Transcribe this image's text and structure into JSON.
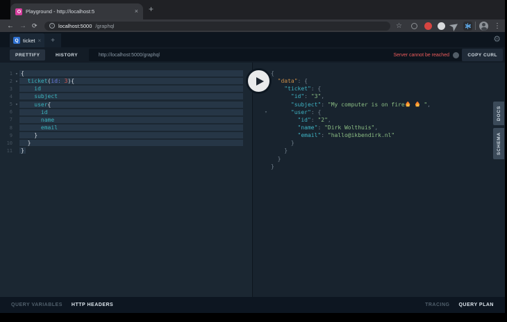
{
  "icons": {
    "back": "←",
    "forward": "→",
    "refresh": "⟳",
    "star": "☆",
    "menu": "⋮",
    "gear": "⚙",
    "fold": "▾",
    "plus": "+",
    "close": "×",
    "info": "i"
  },
  "browser": {
    "tab_title": "Playground - http://localhost:5",
    "url_host": "localhost:5000",
    "url_path": "/graphql"
  },
  "playground": {
    "session_tab": {
      "badge": "Q",
      "label": "ticket"
    },
    "toolbar": {
      "prettify": "PRETTIFY",
      "history": "HISTORY",
      "endpoint": "http://localhost:5000/graphql",
      "status": "Server cannot be reached",
      "copy_curl": "COPY CURL"
    },
    "side_tabs": [
      "DOCS",
      "SCHEMA"
    ],
    "bottom_left": [
      "QUERY VARIABLES",
      "HTTP HEADERS"
    ],
    "bottom_right": [
      "TRACING",
      "QUERY PLAN"
    ],
    "colors": {
      "field": "#3bb3bd",
      "argument": "#6a7ce0",
      "number": "#d1544e",
      "json_key": "#3fb3c4",
      "json_data_key": "#c98c47",
      "json_string": "#8cbe84",
      "status_red": "#ee5c5c",
      "selection": "#263646",
      "pane_bg": "#1b2732"
    },
    "query_editor": {
      "lines": [
        {
          "n": 1,
          "fold": true,
          "sel": "full",
          "segs": [
            {
              "t": "{",
              "c": "p"
            }
          ]
        },
        {
          "n": 2,
          "fold": true,
          "sel": "full",
          "segs": [
            {
              "t": "  ",
              "c": "p"
            },
            {
              "t": "ticket",
              "c": "field"
            },
            {
              "t": "(",
              "c": "p"
            },
            {
              "t": "id:",
              "c": "attr"
            },
            {
              "t": " ",
              "c": "p"
            },
            {
              "t": "3",
              "c": "num"
            },
            {
              "t": "){",
              "c": "p"
            }
          ]
        },
        {
          "n": 3,
          "sel": "full",
          "segs": [
            {
              "t": "    ",
              "c": "p"
            },
            {
              "t": "id",
              "c": "field"
            }
          ]
        },
        {
          "n": 4,
          "sel": "full",
          "segs": [
            {
              "t": "    ",
              "c": "p"
            },
            {
              "t": "subject",
              "c": "field"
            }
          ]
        },
        {
          "n": 5,
          "fold": true,
          "sel": "full",
          "segs": [
            {
              "t": "    ",
              "c": "p"
            },
            {
              "t": "user",
              "c": "field"
            },
            {
              "t": "{",
              "c": "p"
            }
          ]
        },
        {
          "n": 6,
          "sel": "full",
          "segs": [
            {
              "t": "      ",
              "c": "p"
            },
            {
              "t": "id",
              "c": "field"
            }
          ]
        },
        {
          "n": 7,
          "sel": "full",
          "segs": [
            {
              "t": "      ",
              "c": "p"
            },
            {
              "t": "name",
              "c": "field"
            }
          ]
        },
        {
          "n": 8,
          "sel": "full",
          "segs": [
            {
              "t": "      ",
              "c": "p"
            },
            {
              "t": "email",
              "c": "field"
            }
          ]
        },
        {
          "n": 9,
          "sel": "full",
          "segs": [
            {
              "t": "    }",
              "c": "p"
            }
          ]
        },
        {
          "n": 10,
          "sel": "full",
          "segs": [
            {
              "t": "  }",
              "c": "p"
            }
          ]
        },
        {
          "n": 11,
          "sel": "char",
          "segs": [
            {
              "t": "}",
              "c": "p"
            }
          ]
        }
      ]
    },
    "response": {
      "lines": [
        {
          "fold": true,
          "segs": [
            {
              "t": "{",
              "c": "rp"
            }
          ]
        },
        {
          "fold": true,
          "segs": [
            {
              "t": "  ",
              "c": "rp"
            },
            {
              "t": "\"data\"",
              "c": "key1"
            },
            {
              "t": ": {",
              "c": "rp"
            }
          ]
        },
        {
          "fold": true,
          "segs": [
            {
              "t": "    ",
              "c": "rp"
            },
            {
              "t": "\"ticket\"",
              "c": "key"
            },
            {
              "t": ": {",
              "c": "rp"
            }
          ]
        },
        {
          "segs": [
            {
              "t": "      ",
              "c": "rp"
            },
            {
              "t": "\"id\"",
              "c": "key"
            },
            {
              "t": ": ",
              "c": "rp"
            },
            {
              "t": "\"3\"",
              "c": "str"
            },
            {
              "t": ",",
              "c": "rp"
            }
          ]
        },
        {
          "segs": [
            {
              "t": "      ",
              "c": "rp"
            },
            {
              "t": "\"subject\"",
              "c": "key"
            },
            {
              "t": ": ",
              "c": "rp"
            },
            {
              "t": "\"My computer is on fire",
              "c": "str"
            },
            {
              "t": "🔥",
              "c": "flame"
            },
            {
              "t": " ",
              "c": "str"
            },
            {
              "t": "🔥",
              "c": "flame"
            },
            {
              "t": " \"",
              "c": "str"
            },
            {
              "t": ",",
              "c": "rp"
            }
          ]
        },
        {
          "fold": true,
          "segs": [
            {
              "t": "      ",
              "c": "rp"
            },
            {
              "t": "\"user\"",
              "c": "key"
            },
            {
              "t": ": {",
              "c": "rp"
            }
          ]
        },
        {
          "segs": [
            {
              "t": "        ",
              "c": "rp"
            },
            {
              "t": "\"id\"",
              "c": "key"
            },
            {
              "t": ": ",
              "c": "rp"
            },
            {
              "t": "\"2\"",
              "c": "str"
            },
            {
              "t": ",",
              "c": "rp"
            }
          ]
        },
        {
          "segs": [
            {
              "t": "        ",
              "c": "rp"
            },
            {
              "t": "\"name\"",
              "c": "key"
            },
            {
              "t": ": ",
              "c": "rp"
            },
            {
              "t": "\"Dirk Wolthuis\"",
              "c": "str"
            },
            {
              "t": ",",
              "c": "rp"
            }
          ]
        },
        {
          "segs": [
            {
              "t": "        ",
              "c": "rp"
            },
            {
              "t": "\"email\"",
              "c": "key"
            },
            {
              "t": ": ",
              "c": "rp"
            },
            {
              "t": "\"hallo@ikbendirk.nl\"",
              "c": "str"
            }
          ]
        },
        {
          "segs": [
            {
              "t": "      }",
              "c": "rp"
            }
          ]
        },
        {
          "segs": [
            {
              "t": "    }",
              "c": "rp"
            }
          ]
        },
        {
          "segs": [
            {
              "t": "  }",
              "c": "rp"
            }
          ]
        },
        {
          "segs": [
            {
              "t": "}",
              "c": "rp"
            }
          ]
        }
      ]
    }
  }
}
